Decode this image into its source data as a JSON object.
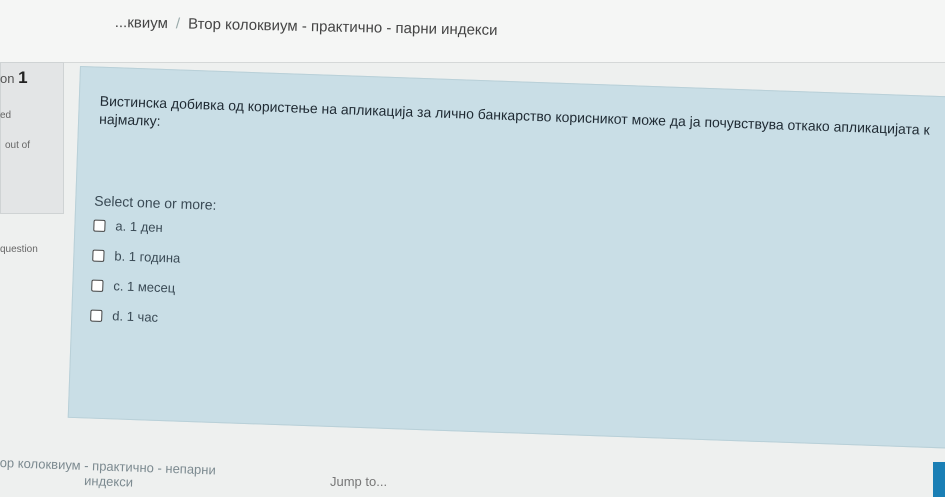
{
  "breadcrumb": {
    "prev": "...квиум",
    "current": "Втор колоквиум - практично - парни индекси"
  },
  "sidebar": {
    "question_label": "on",
    "question_number": "1",
    "state": "ed",
    "marks": "out of",
    "flag": "question"
  },
  "question": {
    "text_line1": "Вистинска добивка од користење на апликација за лично банкарство корисникот може да ја почувствува откако апликацијата к",
    "text_line2": "најмалку:",
    "prompt": "Select one or more:",
    "options": [
      "a. 1 ден",
      "b. 1 година",
      "c. 1 месец",
      "d. 1 час"
    ]
  },
  "footer": {
    "prev_activity_line1": "ор колоквиум - практично - непарни",
    "prev_activity_line2": "индекси",
    "jump_to": "Jump to..."
  },
  "colors": {
    "panel": "#c9dee6",
    "accent": "#1a7fb5"
  }
}
